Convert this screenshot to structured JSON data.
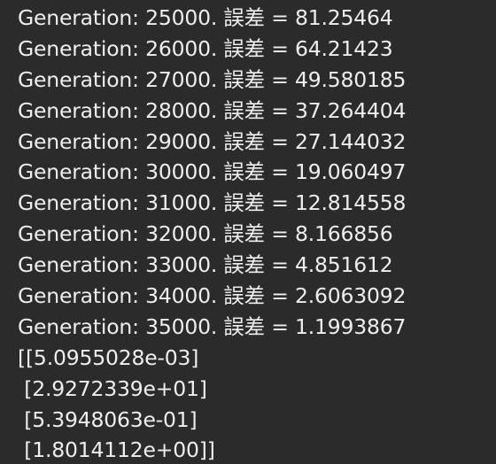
{
  "console": {
    "lines": [
      "Generation: 25000. 誤差 = 81.25464",
      "Generation: 26000. 誤差 = 64.21423",
      "Generation: 27000. 誤差 = 49.580185",
      "Generation: 28000. 誤差 = 37.264404",
      "Generation: 29000. 誤差 = 27.144032",
      "Generation: 30000. 誤差 = 19.060497",
      "Generation: 31000. 誤差 = 12.814558",
      "Generation: 32000. 誤差 = 8.166856",
      "Generation: 33000. 誤差 = 4.851612",
      "Generation: 34000. 誤差 = 2.6063092",
      "Generation: 35000. 誤差 = 1.1993867",
      "[[5.0955028e-03]",
      " [2.9272339e+01]",
      " [5.3948063e-01]",
      " [1.8014112e+00]]"
    ]
  },
  "colors": {
    "background": "#2b2b2b",
    "text": "#eeeeee"
  }
}
